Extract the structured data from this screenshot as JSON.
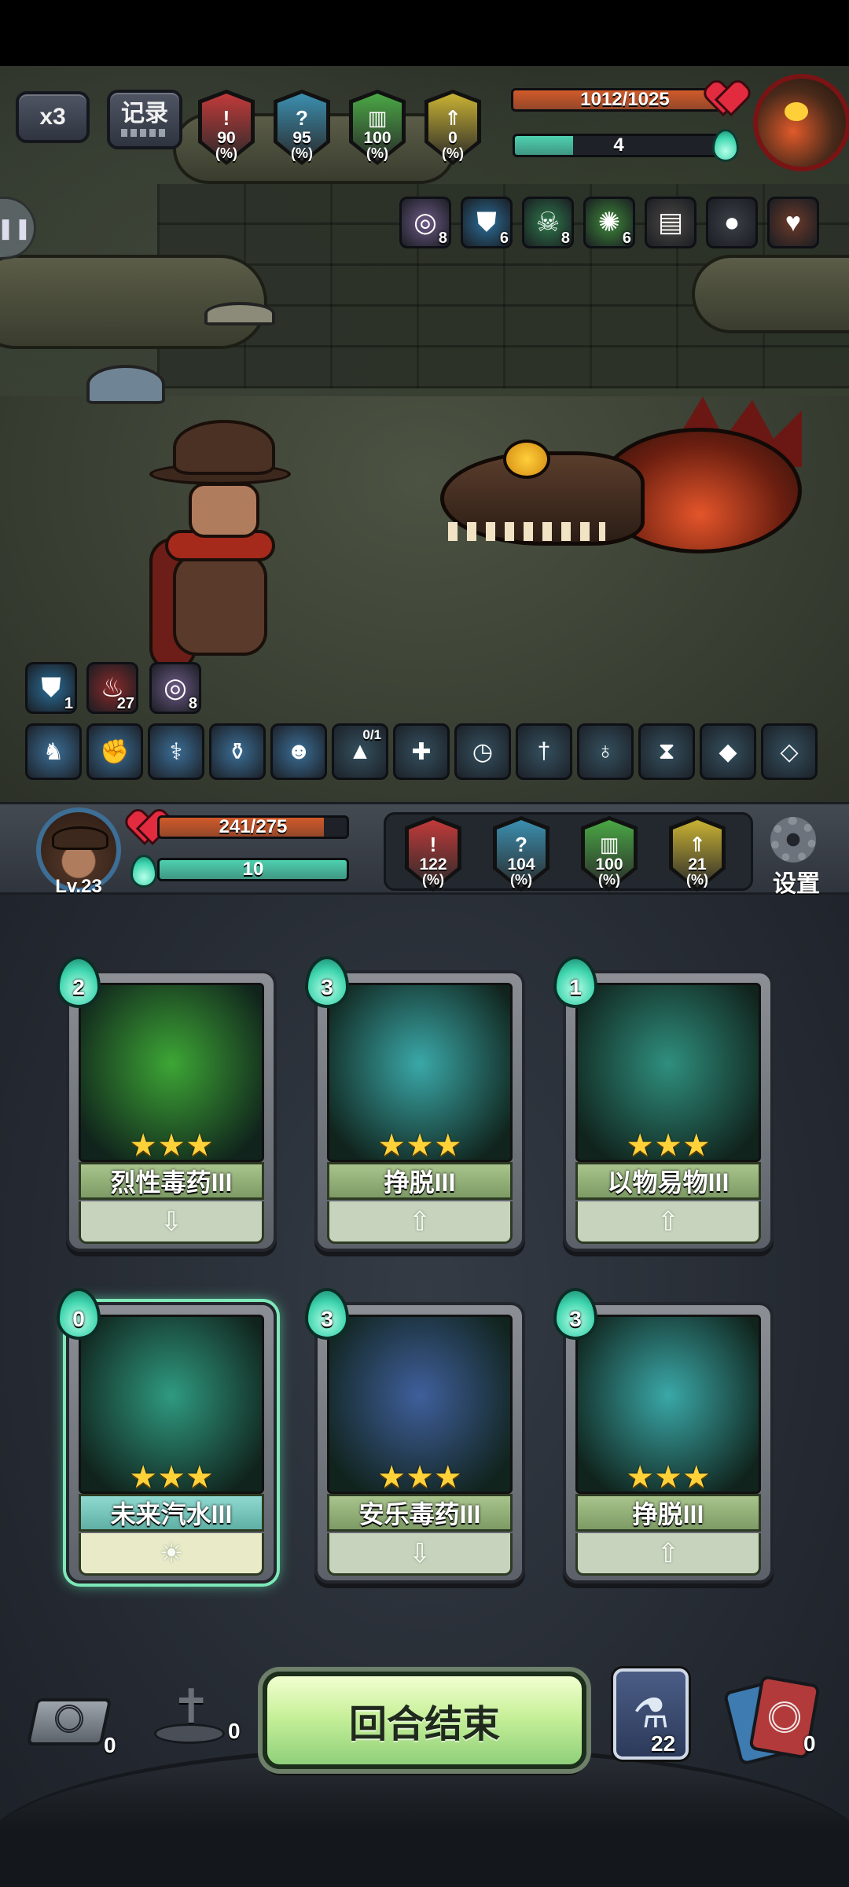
{
  "top_hud": {
    "speed_label": "x3",
    "record_label": "记录",
    "enemy_stats": [
      {
        "symbol": "!",
        "value": "90",
        "unit": "(%)",
        "color": "#c23a3a"
      },
      {
        "symbol": "?",
        "value": "95",
        "unit": "(%)",
        "color": "#3b8fb0"
      },
      {
        "symbol": "▥",
        "value": "100",
        "unit": "(%)",
        "color": "#4aa845"
      },
      {
        "symbol": "⇑",
        "value": "0",
        "unit": "(%)",
        "color": "#c9b233"
      }
    ],
    "enemy_hp": {
      "text": "1012/1025",
      "current": 1012,
      "max": 1025,
      "color": "#d05a2a"
    },
    "enemy_energy": {
      "text": "4",
      "ratio": 0.28,
      "color": "#4fd1b0"
    },
    "enemy_buffs": [
      {
        "icon": "vortex-icon",
        "glyph": "◎",
        "count": "8",
        "color": "#6e5a86"
      },
      {
        "icon": "shield-icon",
        "glyph": "⛊",
        "count": "6",
        "color": "#2b6f9a"
      },
      {
        "icon": "skull-icon",
        "glyph": "☠",
        "count": "8",
        "color": "#2f7a4c"
      },
      {
        "icon": "poison-splash-icon",
        "glyph": "✺",
        "count": "6",
        "color": "#3f8a3a"
      },
      {
        "icon": "book-icon",
        "glyph": "▤",
        "count": "",
        "color": "#4e4a46"
      },
      {
        "icon": "bomb-icon",
        "glyph": "●",
        "count": "",
        "color": "#3c4048"
      },
      {
        "icon": "fire-heart-icon",
        "glyph": "♥",
        "count": "",
        "color": "#6b3a2a"
      }
    ]
  },
  "player_buffs": [
    {
      "icon": "shield-icon",
      "glyph": "⛊",
      "count": "1",
      "color": "#2b6f9a"
    },
    {
      "icon": "bleed-icon",
      "glyph": "♨",
      "count": "27",
      "color": "#8a2a2a"
    },
    {
      "icon": "vortex-icon",
      "glyph": "◎",
      "count": "8",
      "color": "#6e5a86"
    }
  ],
  "relic_slots": [
    {
      "icon": "dragon-relic-icon",
      "glyph": "♞",
      "count": "",
      "color": "#3b6e96"
    },
    {
      "icon": "fist-relic-icon",
      "glyph": "✊",
      "count": "",
      "color": "#3b6e96"
    },
    {
      "icon": "caduceus-relic-icon",
      "glyph": "⚕",
      "count": "",
      "color": "#3b6e96"
    },
    {
      "icon": "potion-relic-icon",
      "glyph": "⚱",
      "count": "",
      "color": "#3b6e96"
    },
    {
      "icon": "demon-relic-icon",
      "glyph": "☻",
      "count": "",
      "color": "#3b6e96"
    },
    {
      "icon": "witch-hat-icon",
      "glyph": "▲",
      "count": "0/1",
      "color": "#34505e"
    },
    {
      "icon": "cross-bandage-icon",
      "glyph": "✚",
      "count": "",
      "color": "#34505e"
    },
    {
      "icon": "stopwatch-icon",
      "glyph": "◷",
      "count": "",
      "color": "#34505e"
    },
    {
      "icon": "dagger-icon",
      "glyph": "†",
      "count": "",
      "color": "#34505e"
    },
    {
      "icon": "pouch-icon",
      "glyph": "♁",
      "count": "",
      "color": "#34505e"
    },
    {
      "icon": "hourglass-icon",
      "glyph": "⧗",
      "count": "",
      "color": "#34505e"
    },
    {
      "icon": "green-orb-icon",
      "glyph": "◆",
      "count": "",
      "color": "#34505e"
    },
    {
      "icon": "crystal-icon",
      "glyph": "◇",
      "count": "",
      "color": "#34505e"
    }
  ],
  "player": {
    "level": "Lv.23",
    "hp": {
      "text": "241/275",
      "current": 241,
      "max": 275,
      "color": "#d05a2a"
    },
    "energy": {
      "text": "10",
      "ratio": 1.0,
      "color": "#4fd1b0"
    },
    "stats": [
      {
        "symbol": "!",
        "value": "122",
        "unit": "(%)",
        "color": "#c23a3a"
      },
      {
        "symbol": "?",
        "value": "104",
        "unit": "(%)",
        "color": "#3b8fb0"
      },
      {
        "symbol": "▥",
        "value": "100",
        "unit": "(%)",
        "color": "#4aa845"
      },
      {
        "symbol": "⇑",
        "value": "21",
        "unit": "(%)",
        "color": "#c9b233"
      }
    ],
    "settings_label": "设置"
  },
  "hand": [
    {
      "name": "烈性毒药III",
      "cost": "2",
      "stars": "★★★",
      "action": "⇩",
      "style": "green",
      "art": "#3da635"
    },
    {
      "name": "挣脱III",
      "cost": "3",
      "stars": "★★★",
      "action": "⇧",
      "style": "green",
      "art": "#3aa8a8"
    },
    {
      "name": "以物易物III",
      "cost": "1",
      "stars": "★★★",
      "action": "⇧",
      "style": "green",
      "art": "#2f8f7e"
    },
    {
      "name": "未来汽水III",
      "cost": "0",
      "stars": "★★★",
      "action": "☀",
      "style": "blue",
      "art": "#2f9a80"
    },
    {
      "name": "安乐毒药III",
      "cost": "3",
      "stars": "★★★",
      "action": "⇩",
      "style": "green",
      "art": "#3f5f9c"
    },
    {
      "name": "挣脱III",
      "cost": "3",
      "stars": "★★★",
      "action": "⇧",
      "style": "green",
      "art": "#3aa8a8"
    }
  ],
  "bottom": {
    "end_turn_label": "回合结束",
    "draw_pile_count": "0",
    "grave_count": "0",
    "potion_deck_count": "22",
    "discard_count": "0"
  }
}
